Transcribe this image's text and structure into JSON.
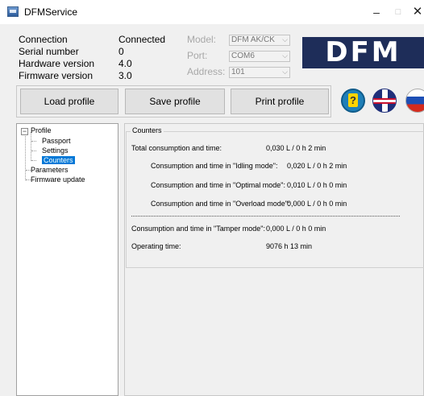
{
  "window": {
    "title": "DFMService",
    "minimize": "–",
    "maximize": "□",
    "close": "✕"
  },
  "info": {
    "connection_label": "Connection",
    "connection_value": "Connected",
    "serial_label": "Serial number",
    "serial_value": "0",
    "hw_label": "Hardware version",
    "hw_value": "4.0",
    "fw_label": "Firmware version",
    "fw_value": "3.0"
  },
  "device": {
    "model_label": "Model:",
    "model_value": "DFM AK/CK",
    "port_label": "Port:",
    "port_value": "COM6",
    "address_label": "Address:",
    "address_value": "101"
  },
  "logo": "DFM",
  "buttons": {
    "load": "Load profile",
    "save": "Save profile",
    "print": "Print profile"
  },
  "tree": {
    "expander": "−",
    "profile": "Profile",
    "passport": "Passport",
    "settings": "Settings",
    "counters": "Counters",
    "parameters": "Parameters",
    "firmware": "Firmware update"
  },
  "counters": {
    "title": "Counters",
    "rows": [
      {
        "label": "Total consumption and time:",
        "value": "0,030 L / 0 h 2 min"
      },
      {
        "label": "Consumption and time in \"Idling mode\":",
        "value": "0,020 L / 0 h 2 min"
      },
      {
        "label": "Consumption and time in \"Optimal mode\":",
        "value": "0,010 L / 0 h 0 min"
      },
      {
        "label": "Consumption and time in \"Overload mode\":",
        "value": "0,000 L / 0 h 0 min"
      },
      {
        "label": "Consumption and time in \"Tamper mode\":",
        "value": "0,000 L / 0 h 0 min"
      },
      {
        "label": "Operating time:",
        "value": "9076 h 13 min"
      }
    ]
  }
}
